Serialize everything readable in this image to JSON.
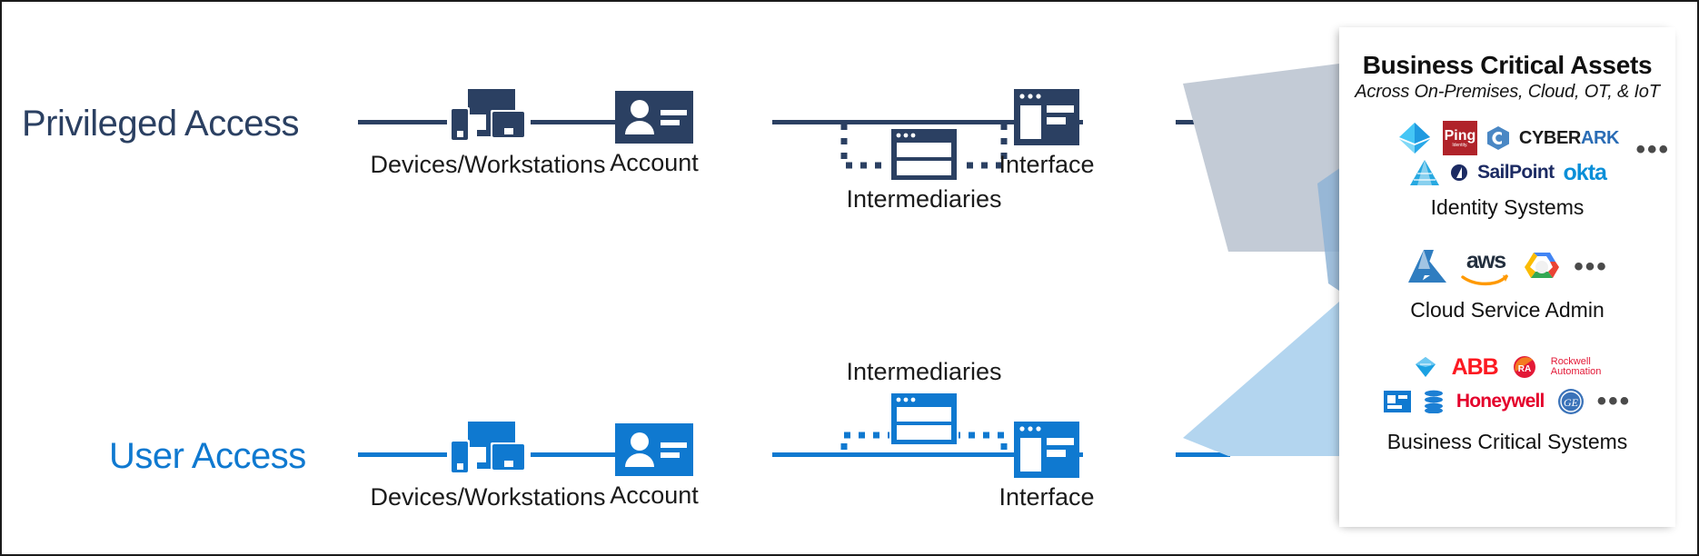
{
  "diagram": {
    "rows": [
      {
        "id": "privileged",
        "label": "Privileged Access",
        "color": "#2b4062",
        "nodes": [
          {
            "name": "devices",
            "caption": "Devices/Workstations",
            "icon": "devices-icon"
          },
          {
            "name": "account",
            "caption": "Account",
            "icon": "id-card-icon"
          },
          {
            "name": "intermediaries",
            "caption": "Intermediaries",
            "icon": "window-intermediary-icon",
            "caption_position": "below"
          },
          {
            "name": "interface",
            "caption": "Interface",
            "icon": "window-interface-icon"
          }
        ]
      },
      {
        "id": "user",
        "label": "User Access",
        "color": "#0f79d0",
        "nodes": [
          {
            "name": "devices",
            "caption": "Devices/Workstations",
            "icon": "devices-icon"
          },
          {
            "name": "account",
            "caption": "Account",
            "icon": "id-card-icon"
          },
          {
            "name": "intermediaries",
            "caption": "Intermediaries",
            "icon": "window-intermediary-icon",
            "caption_position": "above"
          },
          {
            "name": "interface",
            "caption": "Interface",
            "icon": "window-interface-icon"
          }
        ]
      }
    ]
  },
  "funnels": {
    "gray_color": "#c3cbd6",
    "blue_color": "#b3d5ef",
    "overlap_color": "#8fb4d6"
  },
  "assets_panel": {
    "title": "Business Critical Assets",
    "subtitle": "Across On-Premises, Cloud, OT, & IoT",
    "groups": [
      {
        "caption": "Identity Systems",
        "more_indicator": "•••",
        "logos": [
          {
            "name": "azure-active-directory-logo",
            "label": ""
          },
          {
            "name": "ping-identity-logo",
            "label": "Ping",
            "sublabel": "Identity."
          },
          {
            "name": "cyberark-logo",
            "label": "CYBER",
            "label2": "ARK"
          },
          {
            "name": "oracle-identity-logo",
            "label": ""
          },
          {
            "name": "sailpoint-logo",
            "label": "SailPoint"
          },
          {
            "name": "okta-logo",
            "label": "okta"
          }
        ]
      },
      {
        "caption": "Cloud Service Admin",
        "more_indicator": "•••",
        "logos": [
          {
            "name": "microsoft-azure-logo",
            "label": ""
          },
          {
            "name": "aws-logo",
            "label": "aws"
          },
          {
            "name": "google-cloud-logo",
            "label": ""
          }
        ]
      },
      {
        "caption": "Business Critical Systems",
        "more_indicator": "•••",
        "logos": [
          {
            "name": "sap-logo",
            "label": ""
          },
          {
            "name": "abb-logo",
            "label": "ABB"
          },
          {
            "name": "rockwell-automation-logo",
            "label": "Rockwell",
            "label2": "Automation"
          },
          {
            "name": "siemens-logo",
            "label": ""
          },
          {
            "name": "oracle-db-logo",
            "label": ""
          },
          {
            "name": "honeywell-logo",
            "label": "Honeywell"
          },
          {
            "name": "general-electric-logo",
            "label": ""
          }
        ]
      }
    ]
  }
}
